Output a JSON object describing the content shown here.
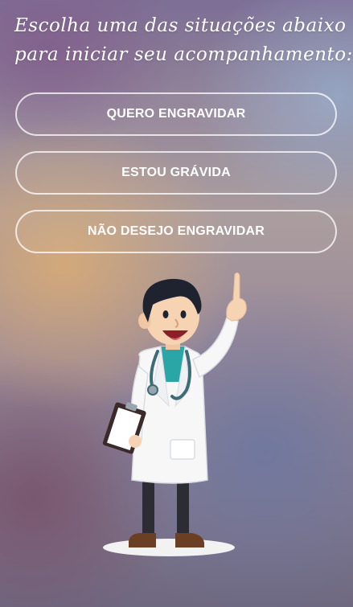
{
  "heading": {
    "line1": "Escolha uma das situações abaixo",
    "line2": "para iniciar seu acompanhamento:"
  },
  "options": [
    {
      "label": "QUERO ENGRAVIDAR"
    },
    {
      "label": "ESTOU GRÁVIDA"
    },
    {
      "label": "NÃO DESEJO ENGRAVIDAR"
    }
  ],
  "illustration": {
    "icon": "doctor-illustration"
  }
}
